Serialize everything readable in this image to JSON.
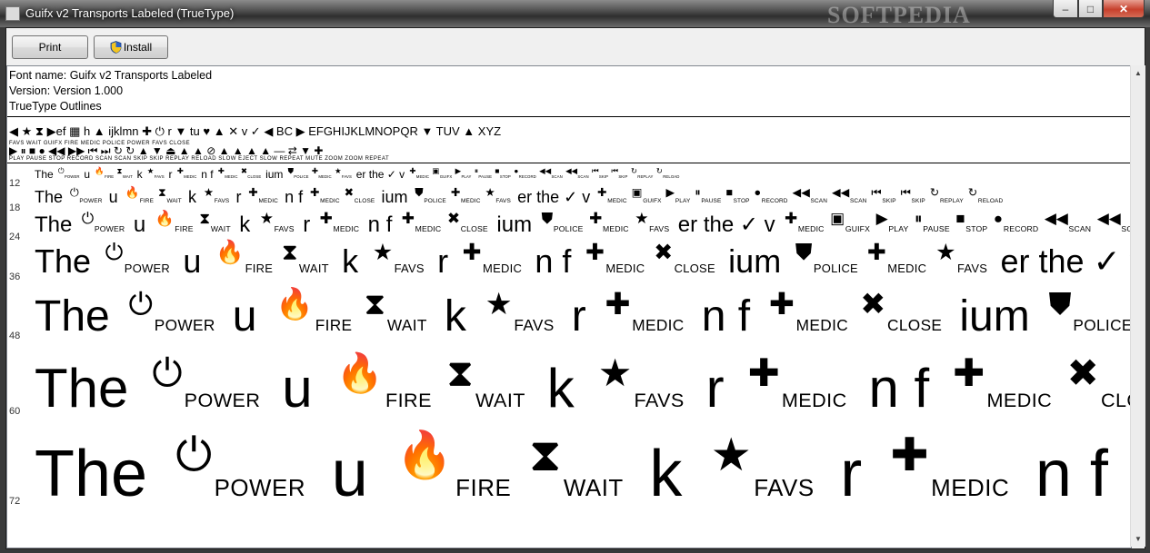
{
  "window": {
    "title": "Guifx v2 Transports Labeled (TrueType)",
    "watermark": "SOFTPEDIA",
    "controls": {
      "minimize": "–",
      "maximize": "□",
      "close": "✕"
    }
  },
  "toolbar": {
    "print_label": "Print",
    "install_label": "Install"
  },
  "info": {
    "font_name": "Font name: Guifx v2 Transports Labeled",
    "version": "Version: Version 1.000",
    "outlines": "TrueType Outlines"
  },
  "charset": {
    "line1": "◀ ★ ⧗ ▶ef ▦ h ▲ ijklmn ✚ ⏻ r ▼ tu ♥ ▲ ✕ v ✓ ◀ BC ▶ EFGHIJKLMNOPQR ▼ TUV ▲ XYZ",
    "line1_labels": "FAVS WAIT GUIFX FIRE MEDIC POLICE POWER FAVS CLOSE",
    "line2": "▶ ⏸ ■ ● ◀◀ ▶▶ ⏮ ⏭ ↻ ↻ ▲ ▼ ⏏ ▲ ▲ ⊘ ▲ ▲ ▲ ▲ — ⇄ ▼ ✚",
    "line2_labels": "PLAY PAUSE STOP RECORD SCAN SCAN SKIP SKIP REPLAY RELOAD SLOW EJECT SLOW REPEAT MUTE ZOOM ZOOM REPEAT"
  },
  "samples": [
    {
      "size": "12",
      "text": "The POWER u FIRE WAIT k FAVS r MEDIC n f MEDIC CLOSE ium POLICE MEDIC FAVS er the ✓ v MEDIC GUIFX PLAY PAUSE STOP RECORD SCAN SCAN SKIP SKIP REPLAY RELOAD"
    },
    {
      "size": "18",
      "text": "The POWER u FIRE WAIT k FAVS r MEDIC n f MEDIC CLOSE ium POLICE MEDIC FAVS er the ✓ v MEDIC GUIFX PLAY PAUSE STOP RECORD SCAN SCAN SKIP SKIP REPLAY RELOAD"
    },
    {
      "size": "24",
      "text": "The POWER u FIRE WAIT k FAVS r MEDIC n f MEDIC CLOSE ium POLICE MEDIC FAVS er the ✓ v MEDIC GUIFX PLAY PAUSE STOP RECORD SCAN SCAN SKIP SKIP REPLAY RELOAD"
    },
    {
      "size": "36",
      "text": "The POWER u FIRE WAIT k FAVS r MEDIC n f MEDIC CLOSE ium POLICE MEDIC FAVS er the ✓ v MEDIC GUIFX"
    },
    {
      "size": "48",
      "text": "The POWER u FIRE WAIT k FAVS r MEDIC n f MEDIC CLOSE ium POLICE MEDIC FAVS er th"
    },
    {
      "size": "60",
      "text": "The POWER u FIRE WAIT k FAVS r MEDIC n f MEDIC CLOSE ium POLICE"
    },
    {
      "size": "72",
      "text": "The POWER u FIRE WAIT k FAVS r MEDIC n f MEDIC CLOSE iu"
    }
  ],
  "sample_words": {
    "the": "The",
    "power": "POWER",
    "u": "u",
    "fire": "FIRE",
    "wait": "WAIT",
    "k": "k",
    "favs": "FAVS",
    "r": "r",
    "medic": "MEDIC",
    "n": "n",
    "f": "f",
    "close": "CLOSE",
    "ium": "ium",
    "police": "POLICE",
    "er": "er",
    "the2": "the",
    "v": "v",
    "guifx": "GUIFX",
    "play": "PLAY",
    "pause": "PAUSE",
    "stop": "STOP",
    "record": "RECORD",
    "scan": "SCAN",
    "skip": "SKIP",
    "replay": "REPLAY",
    "reload": "RELOAD"
  },
  "icons": {
    "app": "font-file-icon",
    "install": "uac-shield-icon"
  }
}
